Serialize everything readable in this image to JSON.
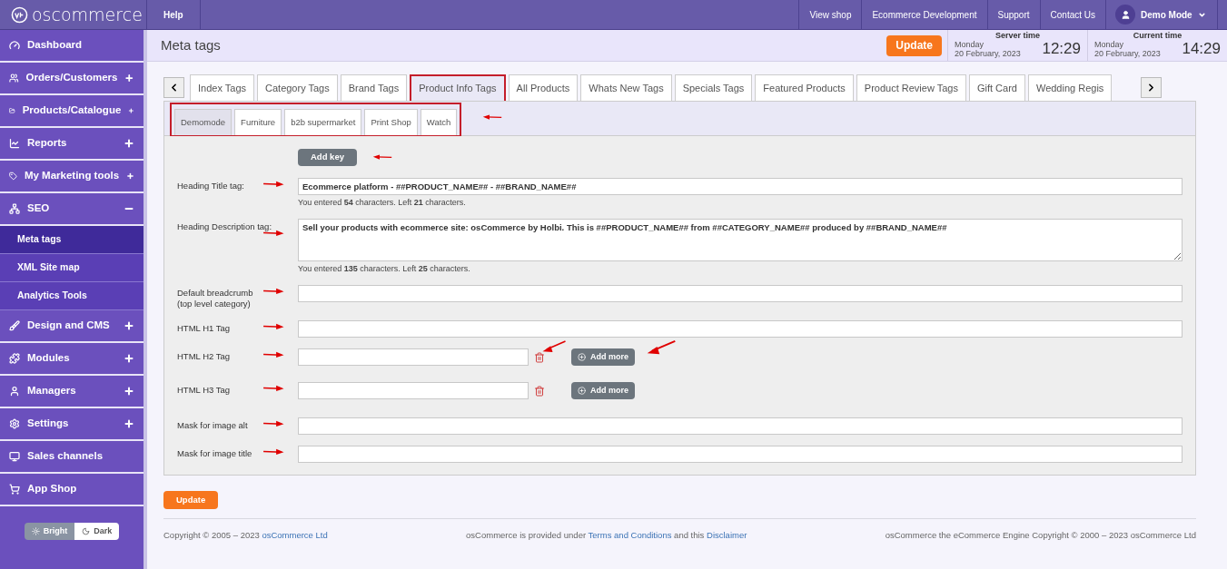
{
  "topbar": {
    "logo": "oscommerce",
    "help": "Help",
    "links": [
      "View shop",
      "Ecommerce Development",
      "Support",
      "Contact Us"
    ],
    "user": "Demo Mode"
  },
  "sidebar": {
    "items": [
      {
        "label": "Dashboard",
        "kind": "link"
      },
      {
        "label": "Orders/Customers",
        "kind": "group",
        "expanded": false
      },
      {
        "label": "Products/Catalogue",
        "kind": "group",
        "expanded": false
      },
      {
        "label": "Reports",
        "kind": "group",
        "expanded": false
      },
      {
        "label": "My Marketing tools",
        "kind": "group",
        "expanded": false
      },
      {
        "label": "SEO",
        "kind": "group",
        "expanded": true,
        "children": [
          {
            "label": "Meta tags",
            "selected": true
          },
          {
            "label": "XML Site map",
            "selected": false
          },
          {
            "label": "Analytics Tools",
            "selected": false
          }
        ]
      },
      {
        "label": "Design and CMS",
        "kind": "group",
        "expanded": false
      },
      {
        "label": "Modules",
        "kind": "group",
        "expanded": false
      },
      {
        "label": "Managers",
        "kind": "group",
        "expanded": false
      },
      {
        "label": "Settings",
        "kind": "group",
        "expanded": false
      },
      {
        "label": "Sales channels",
        "kind": "link"
      },
      {
        "label": "App Shop",
        "kind": "link"
      }
    ],
    "theme": [
      {
        "label": "Bright",
        "selected": true
      },
      {
        "label": "Dark",
        "selected": false
      }
    ]
  },
  "header": {
    "title": "Meta tags",
    "update": "Update",
    "clocks": [
      {
        "label": "Server time",
        "day": "Monday",
        "date": "20 February, 2023",
        "time": "12:29"
      },
      {
        "label": "Current time",
        "day": "Monday",
        "date": "20 February, 2023",
        "time": "14:29"
      }
    ]
  },
  "tabs": [
    {
      "label": "Index Tags",
      "selected": false,
      "highlighted": false
    },
    {
      "label": "Category Tags",
      "selected": false,
      "highlighted": false
    },
    {
      "label": "Brand Tags",
      "selected": false,
      "highlighted": false
    },
    {
      "label": "Product Info Tags",
      "selected": true,
      "highlighted": true
    },
    {
      "label": "All Products",
      "selected": false,
      "highlighted": false
    },
    {
      "label": "Whats New Tags",
      "selected": false,
      "highlighted": false
    },
    {
      "label": "Specials Tags",
      "selected": false,
      "highlighted": false
    },
    {
      "label": "Featured Products",
      "selected": false,
      "highlighted": false
    },
    {
      "label": "Product Review Tags",
      "selected": false,
      "highlighted": false
    },
    {
      "label": "Gift Card",
      "selected": false,
      "highlighted": false
    },
    {
      "label": "Wedding Regis",
      "selected": false,
      "highlighted": false
    }
  ],
  "subtabs": [
    {
      "label": "Demomode",
      "selected": true
    },
    {
      "label": "Furniture",
      "selected": false
    },
    {
      "label": "b2b supermarket",
      "selected": false
    },
    {
      "label": "Print Shop",
      "selected": false
    },
    {
      "label": "Watch",
      "selected": false
    }
  ],
  "add_key": "Add key",
  "fields": [
    {
      "kind": "text",
      "label": "Heading Title tag:",
      "value": "Ecommerce platform - ##PRODUCT_NAME## - ##BRAND_NAME##",
      "hint": "You entered **54** characters. Left **21** characters."
    },
    {
      "kind": "textarea",
      "label": "Heading Description tag:",
      "value": "Sell your products with ecommerce site: osCommerce by Holbi. This is ##PRODUCT_NAME## from ##CATEGORY_NAME## produced by ##BRAND_NAME##",
      "hint": "You entered **135** characters. Left **25** characters."
    },
    {
      "kind": "text",
      "label": "Default breadcrumb (top level category)"
    },
    {
      "kind": "text",
      "label": "HTML H1 Tag"
    },
    {
      "kind": "multi",
      "label": "HTML H2 Tag",
      "add": "Add more"
    },
    {
      "kind": "multi",
      "label": "HTML H3 Tag",
      "add": "Add more"
    },
    {
      "kind": "text",
      "label": "Mask for image alt"
    },
    {
      "kind": "text",
      "label": "Mask for image title"
    }
  ],
  "update": "Update",
  "footer": {
    "left": "Copyright © 2005 – 2023 ",
    "left_link": "osCommerce Ltd",
    "mid": "osCommerce is provided under ",
    "mid_link1": "Terms and Conditions",
    "mid_and": " and this ",
    "mid_link2": "Disclaimer",
    "right": "osCommerce the eCommerce Engine Copyright © 2000 – 2023 osCommerce Ltd"
  }
}
